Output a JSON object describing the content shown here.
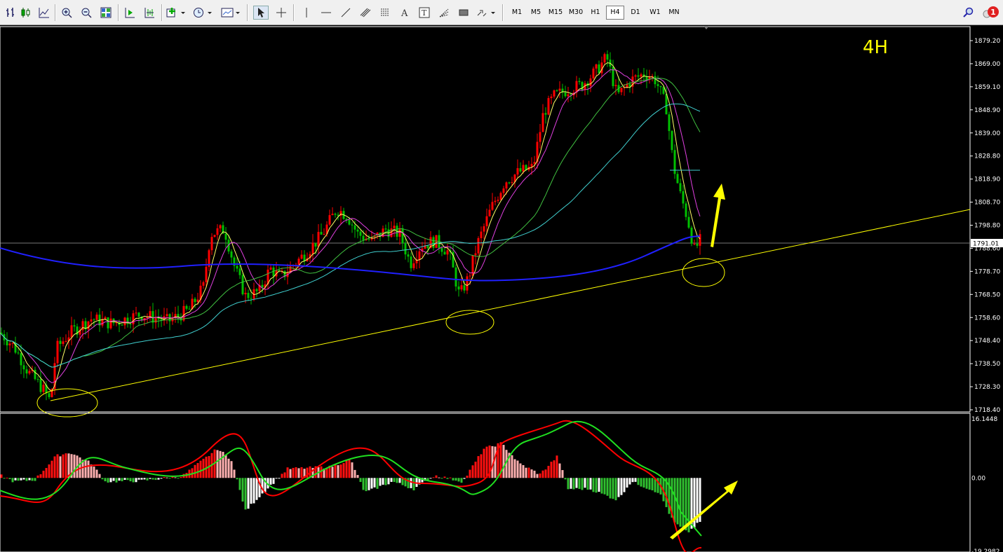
{
  "toolbar": {
    "timeframes": [
      "M1",
      "M5",
      "M15",
      "M30",
      "H1",
      "H4",
      "D1",
      "W1",
      "MN"
    ],
    "active_timeframe": "H4",
    "notification_count": "1"
  },
  "chart": {
    "timeframe_label": "4H",
    "current_price": "1791.01",
    "price_axis": [
      "1879.20",
      "1869.00",
      "1859.10",
      "1848.90",
      "1839.00",
      "1828.80",
      "1818.90",
      "1808.70",
      "1798.80",
      "1788.60",
      "1778.70",
      "1768.50",
      "1758.60",
      "1748.40",
      "1738.50",
      "1728.30",
      "1718.40"
    ],
    "macd_axis": {
      "top": "16.1448",
      "zero": "0.00",
      "bottom": "-19.2982"
    },
    "colors": {
      "up_candle": "#ff0000",
      "down_candle": "#00c000",
      "trendline": "#ffff00",
      "ma_fast": "#ffff66",
      "ma_magenta": "#e040e0",
      "ma_green": "#40c040",
      "ma_cyan": "#40d0d0",
      "ma_blue": "#2020ff",
      "macd_line": "#ff0000",
      "signal_line": "#20e020"
    }
  }
}
